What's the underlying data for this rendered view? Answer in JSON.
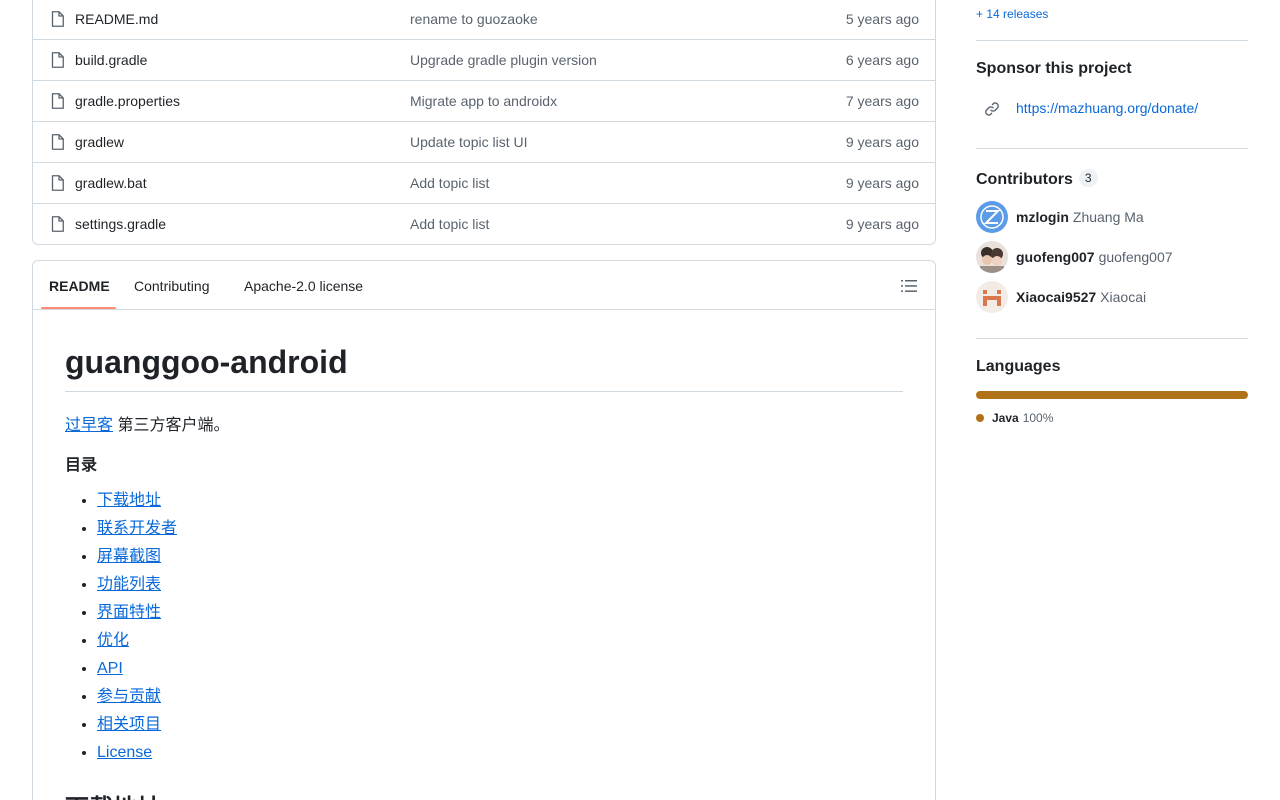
{
  "files": [
    {
      "name": "README.md",
      "message": "rename to guozaoke",
      "time": "5 years ago"
    },
    {
      "name": "build.gradle",
      "message": "Upgrade gradle plugin version",
      "time": "6 years ago"
    },
    {
      "name": "gradle.properties",
      "message": "Migrate app to androidx",
      "time": "7 years ago"
    },
    {
      "name": "gradlew",
      "message": "Update topic list UI",
      "time": "9 years ago"
    },
    {
      "name": "gradlew.bat",
      "message": "Add topic list",
      "time": "9 years ago"
    },
    {
      "name": "settings.gradle",
      "message": "Add topic list",
      "time": "9 years ago"
    }
  ],
  "readme": {
    "tabs": [
      "README",
      "Contributing",
      "Apache-2.0 license"
    ],
    "title": "guanggoo-android",
    "intro_link": "过早客",
    "intro_text": " 第三方客户端。",
    "toc_heading": "目录",
    "toc": [
      "下载地址",
      "联系开发者",
      "屏幕截图",
      "功能列表",
      "界面特性",
      "优化",
      "API",
      "参与贡献",
      "相关项目",
      "License"
    ],
    "next_heading": "下载地址"
  },
  "sidebar": {
    "releases_link": "+ 14 releases",
    "sponsor_heading": "Sponsor this project",
    "sponsor_link": "https://mazhuang.org/donate/",
    "contributors_heading": "Contributors",
    "contributors_count": "3",
    "contributors": [
      {
        "login": "mzlogin",
        "name": "Zhuang Ma"
      },
      {
        "login": "guofeng007",
        "name": "guofeng007"
      },
      {
        "login": "Xiaocai9527",
        "name": "Xiaocai"
      }
    ],
    "languages_heading": "Languages",
    "languages": [
      {
        "name": "Java",
        "percent": "100%",
        "color": "#b07219"
      }
    ]
  },
  "colors": {
    "link": "#0969da",
    "border": "#d1d9e0",
    "muted": "#59636e",
    "tab_accent": "#fd8c73"
  }
}
